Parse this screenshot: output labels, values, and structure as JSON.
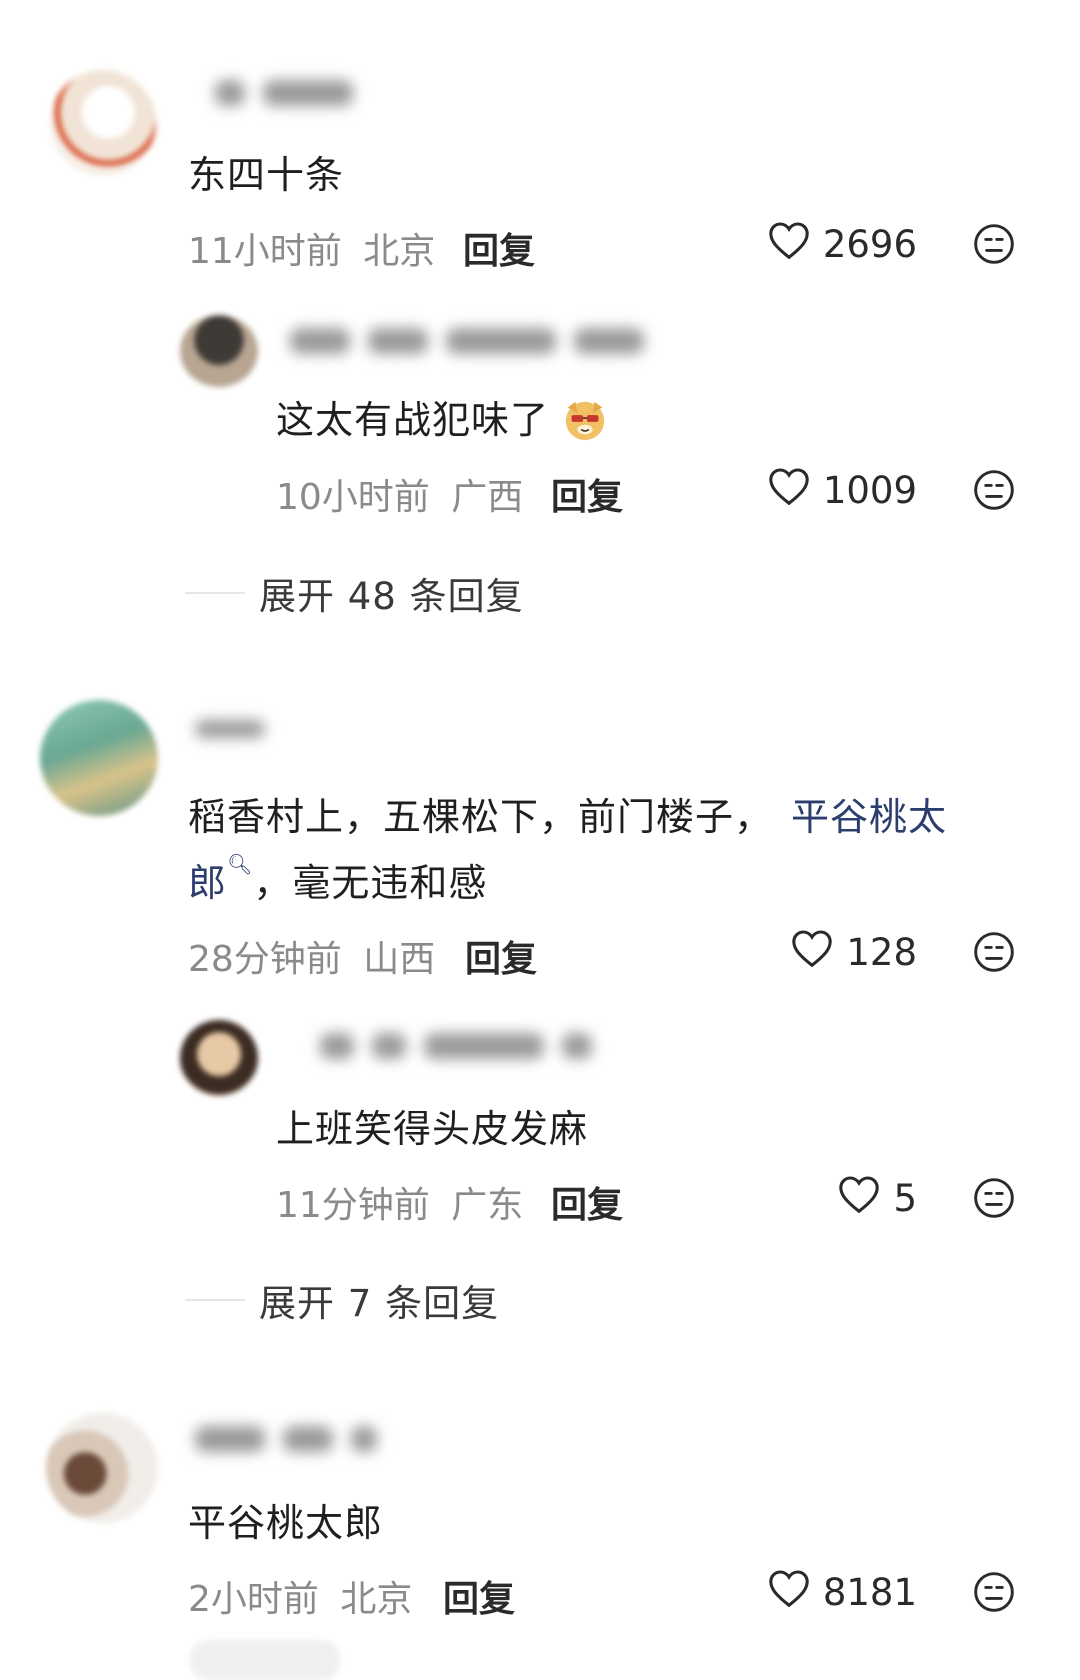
{
  "comments": [
    {
      "text": "东四十条",
      "time": "11小时前",
      "location": "北京",
      "reply_label": "回复",
      "likes": "2696",
      "avatar_colors": [
        "#f3e6da",
        "#c0432a"
      ]
    },
    {
      "text": "这太有战犯味了",
      "time": "10小时前",
      "location": "广西",
      "reply_label": "回复",
      "likes": "1009",
      "avatar_colors": [
        "#5a5048",
        "#b8a592"
      ]
    },
    {
      "text_part1": "稻香村上，五棵松下，前门楼子，",
      "link_text": "平谷桃太",
      "line2_link": "郎",
      "line2_rest": "，毫无违和感",
      "time": "28分钟前",
      "location": "山西",
      "reply_label": "回复",
      "likes": "128",
      "avatar_colors": [
        "#7fb3a1",
        "#d8c38a"
      ]
    },
    {
      "text": "上班笑得头皮发麻",
      "time": "11分钟前",
      "location": "广东",
      "reply_label": "回复",
      "likes": "5",
      "avatar_colors": [
        "#3b2b22",
        "#e8c9a6"
      ]
    },
    {
      "text": "平谷桃太郎",
      "time": "2小时前",
      "location": "北京",
      "reply_label": "回复",
      "likes": "8181",
      "avatar_colors": [
        "#8a6a58",
        "#3ea67a"
      ]
    }
  ],
  "expand": [
    {
      "label": "展开 48 条回复"
    },
    {
      "label": "展开 7 条回复"
    }
  ],
  "icons": {
    "like": "heart-outline-icon",
    "reaction": "meh-face-icon",
    "emoji": "dog-sunglasses-emoji",
    "search": "search-icon"
  }
}
